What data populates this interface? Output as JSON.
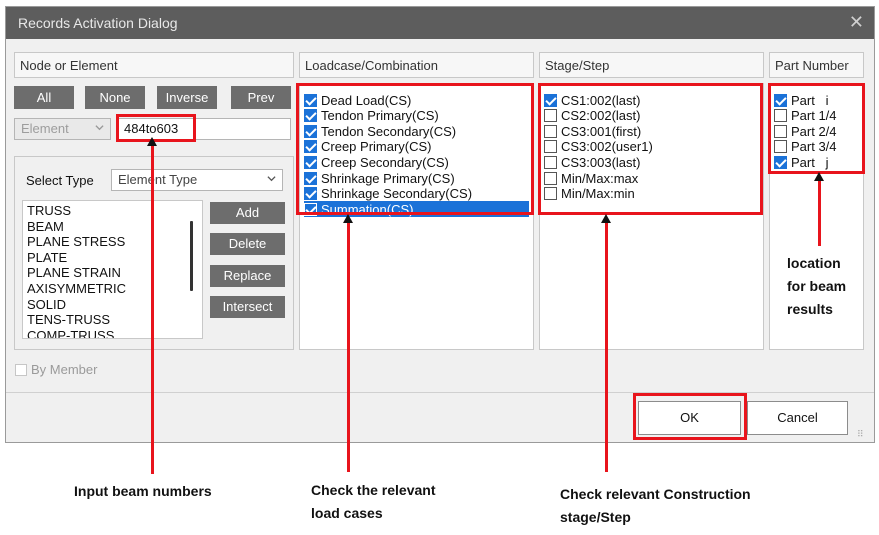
{
  "dialog": {
    "title": "Records Activation Dialog",
    "close_glyph": "✕"
  },
  "node_element": {
    "header": "Node or Element",
    "buttons": {
      "all": "All",
      "none": "None",
      "inverse": "Inverse",
      "prev": "Prev"
    },
    "type_select_value": "Element",
    "element_input_value": "484to603",
    "select_type_label": "Select Type",
    "select_type_value": "Element Type",
    "type_list": [
      "TRUSS",
      "BEAM",
      "PLANE STRESS",
      "PLATE",
      "PLANE STRAIN",
      "AXISYMMETRIC",
      "SOLID",
      "TENS-TRUSS",
      "COMP-TRUSS"
    ],
    "action_buttons": {
      "add": "Add",
      "delete": "Delete",
      "replace": "Replace",
      "intersect": "Intersect"
    },
    "by_member_label": "By Member"
  },
  "loadcase": {
    "header": "Loadcase/Combination",
    "items": [
      {
        "label": "Dead Load(CS)",
        "checked": true
      },
      {
        "label": "Tendon Primary(CS)",
        "checked": true
      },
      {
        "label": "Tendon Secondary(CS)",
        "checked": true
      },
      {
        "label": "Creep Primary(CS)",
        "checked": true
      },
      {
        "label": "Creep Secondary(CS)",
        "checked": true
      },
      {
        "label": "Shrinkage Primary(CS)",
        "checked": true
      },
      {
        "label": "Shrinkage Secondary(CS)",
        "checked": true
      },
      {
        "label": "Summation(CS)",
        "checked": true,
        "selected": true
      }
    ]
  },
  "stage": {
    "header": "Stage/Step",
    "items": [
      {
        "label": "CS1:002(last)",
        "checked": true
      },
      {
        "label": "CS2:002(last)",
        "checked": false
      },
      {
        "label": "CS3:001(first)",
        "checked": false
      },
      {
        "label": "CS3:002(user1)",
        "checked": false
      },
      {
        "label": "CS3:003(last)",
        "checked": false
      },
      {
        "label": "Min/Max:max",
        "checked": false
      },
      {
        "label": "Min/Max:min",
        "checked": false
      }
    ]
  },
  "part": {
    "header": "Part Number",
    "items": [
      {
        "label": "Part   i",
        "checked": true
      },
      {
        "label": "Part 1/4",
        "checked": false
      },
      {
        "label": "Part 2/4",
        "checked": false
      },
      {
        "label": "Part 3/4",
        "checked": false
      },
      {
        "label": "Part   j",
        "checked": true
      }
    ]
  },
  "footer": {
    "ok_label": "OK",
    "cancel_label": "Cancel"
  },
  "annotations": {
    "input_beam_numbers": "Input beam numbers",
    "load_cases_line1": "Check the relevant",
    "load_cases_line2": "load cases",
    "stage_line1": "Check relevant Construction",
    "stage_line2": "stage/Step",
    "location_line1": "location",
    "location_line2": "for beam",
    "location_line3": "results"
  },
  "colors": {
    "titlebar": "#5d5d5d",
    "accent_blue": "#1b72d8",
    "highlight_red": "#e8141c",
    "button_gray": "#6d6d6d"
  }
}
